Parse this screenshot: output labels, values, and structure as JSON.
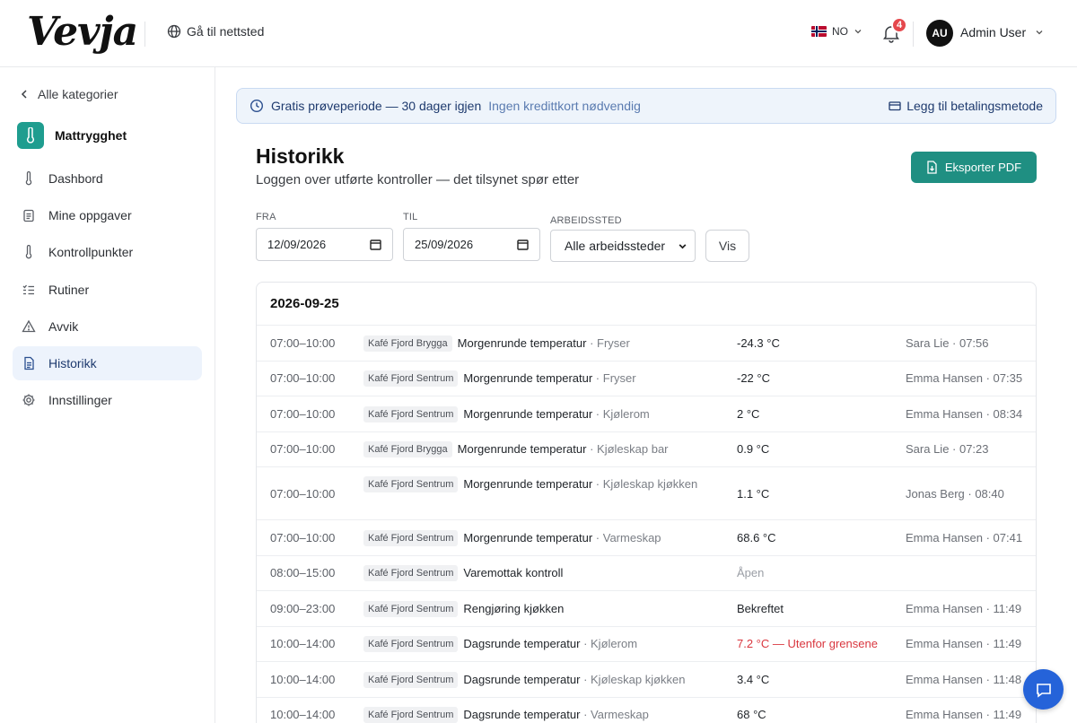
{
  "header": {
    "logo_text": "Vevja",
    "site_link": "Gå til nettsted",
    "language": "NO",
    "notification_count": "4",
    "avatar_initials": "AU",
    "user_name": "Admin User"
  },
  "sidebar": {
    "back_label": "Alle kategorier",
    "category": "Mattrygghet",
    "items": [
      {
        "label": "Dashbord",
        "icon": "thermometer-icon",
        "active": false
      },
      {
        "label": "Mine oppgaver",
        "icon": "clipboard-icon",
        "active": false
      },
      {
        "label": "Kontrollpunkter",
        "icon": "thermometer-icon",
        "active": false
      },
      {
        "label": "Rutiner",
        "icon": "checklist-icon",
        "active": false
      },
      {
        "label": "Avvik",
        "icon": "warning-icon",
        "active": false
      },
      {
        "label": "Historikk",
        "icon": "document-icon",
        "active": true
      },
      {
        "label": "Innstillinger",
        "icon": "gear-icon",
        "active": false
      }
    ]
  },
  "trial": {
    "title": "Gratis prøveperiode — 30 dager igjen",
    "note": "Ingen kredittkort nødvendig",
    "action": "Legg til betalingsmetode"
  },
  "page": {
    "title": "Historikk",
    "subtitle": "Loggen over utførte kontroller — det tilsynet spør etter",
    "export_label": "Eksporter PDF"
  },
  "filters": {
    "from_label": "FRA",
    "from_value": "12/09/2026",
    "to_label": "TIL",
    "to_value": "25/09/2026",
    "workplace_label": "ARBEIDSSTED",
    "workplace_value": "Alle arbeidssteder",
    "show_label": "Vis"
  },
  "log": {
    "date": "2026-09-25",
    "rows": [
      {
        "time": "07:00–10:00",
        "place": "Kafé Fjord Brygga",
        "task": "Morgenrunde temperatur",
        "location": "Fryser",
        "value": "-24.3 °C",
        "status": "normal",
        "who": "Sara Lie · 07:56"
      },
      {
        "time": "07:00–10:00",
        "place": "Kafé Fjord Sentrum",
        "task": "Morgenrunde temperatur",
        "location": "Fryser",
        "value": "-22 °C",
        "status": "normal",
        "who": "Emma Hansen · 07:35"
      },
      {
        "time": "07:00–10:00",
        "place": "Kafé Fjord Sentrum",
        "task": "Morgenrunde temperatur",
        "location": "Kjølerom",
        "value": "2 °C",
        "status": "normal",
        "who": "Emma Hansen · 08:34"
      },
      {
        "time": "07:00–10:00",
        "place": "Kafé Fjord Brygga",
        "task": "Morgenrunde temperatur",
        "location": "Kjøleskap bar",
        "value": "0.9 °C",
        "status": "normal",
        "who": "Sara Lie · 07:23"
      },
      {
        "time": "07:00–10:00",
        "place": "Kafé Fjord Sentrum",
        "task": "Morgenrunde temperatur",
        "location": "Kjøleskap kjøkken",
        "value": "1.1 °C",
        "status": "normal",
        "who": "Jonas Berg · 08:40"
      },
      {
        "time": "07:00–10:00",
        "place": "Kafé Fjord Sentrum",
        "task": "Morgenrunde temperatur",
        "location": "Varmeskap",
        "value": "68.6 °C",
        "status": "normal",
        "who": "Emma Hansen · 07:41"
      },
      {
        "time": "08:00–15:00",
        "place": "Kafé Fjord Sentrum",
        "task": "Varemottak kontroll",
        "location": "",
        "value": "Åpen",
        "status": "open",
        "who": ""
      },
      {
        "time": "09:00–23:00",
        "place": "Kafé Fjord Sentrum",
        "task": "Rengjøring kjøkken",
        "location": "",
        "value": "Bekreftet",
        "status": "normal",
        "who": "Emma Hansen · 11:49"
      },
      {
        "time": "10:00–14:00",
        "place": "Kafé Fjord Sentrum",
        "task": "Dagsrunde temperatur",
        "location": "Kjølerom",
        "value": "7.2 °C — Utenfor grensene",
        "status": "alert",
        "who": "Emma Hansen · 11:49"
      },
      {
        "time": "10:00–14:00",
        "place": "Kafé Fjord Sentrum",
        "task": "Dagsrunde temperatur",
        "location": "Kjøleskap kjøkken",
        "value": "3.4 °C",
        "status": "normal",
        "who": "Emma Hansen · 11:48"
      },
      {
        "time": "10:00–14:00",
        "place": "Kafé Fjord Sentrum",
        "task": "Dagsrunde temperatur",
        "location": "Varmeskap",
        "value": "68 °C",
        "status": "normal",
        "who": "Emma Hansen · 11:49"
      }
    ]
  },
  "colors": {
    "accent": "#1f8f82",
    "alert": "#d9363e",
    "chat": "#2563d9"
  }
}
